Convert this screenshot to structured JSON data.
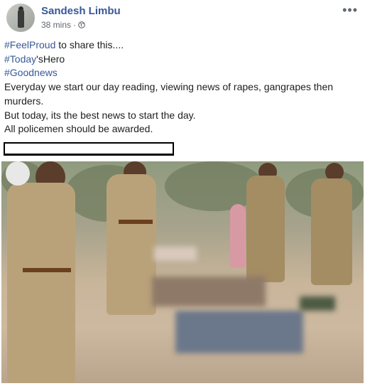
{
  "post": {
    "author": "Sandesh Limbu",
    "time": "38 mins",
    "separator": "·",
    "more": "•••",
    "lines": {
      "l1_tag": "#FeelProud",
      "l1_rest": " to share this....",
      "l2_tag": "#Today",
      "l2_rest": "'sHero",
      "l3_tag": "#Goodnews",
      "l4": "Everyday we start our day reading, viewing news of rapes, gangrapes then murders.",
      "l5": "But today, its the best news to start the day.",
      "l6": "All policemen should be awarded."
    }
  },
  "colors": {
    "link": "#385898",
    "text": "#1c1e21",
    "meta": "#606770"
  },
  "icons": [
    "avatar",
    "globe-icon",
    "more-options-icon"
  ]
}
